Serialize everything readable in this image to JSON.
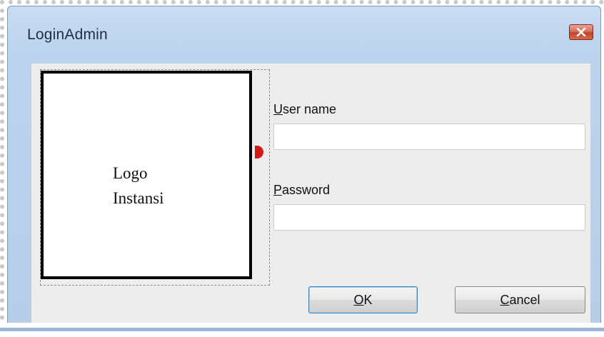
{
  "window": {
    "title": "LoginAdmin",
    "close_icon": "close-icon"
  },
  "logo": {
    "line1": "Logo",
    "line2": "Instansi"
  },
  "form": {
    "username_label": "User name",
    "username_value": "",
    "password_label": "Password",
    "password_value": "",
    "ok_label": "OK",
    "cancel_label": "Cancel"
  },
  "colors": {
    "title_bar": "#c9dcf2",
    "close_button": "#c9452f",
    "client_area": "#ededed",
    "ok_focus_border": "#3c7fb1"
  }
}
